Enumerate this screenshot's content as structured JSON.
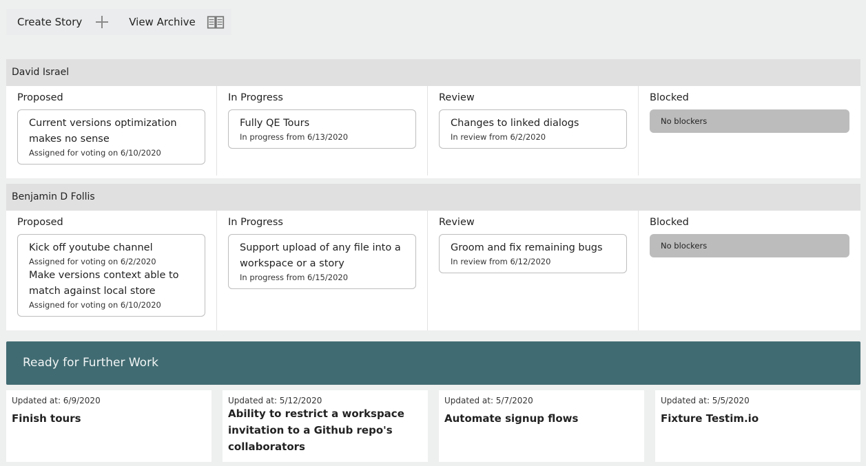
{
  "toolbar": {
    "create_label": "Create Story",
    "archive_label": "View Archive",
    "plus_icon": "plus-icon",
    "archive_icon": "book-icon"
  },
  "people": [
    {
      "name": "David Israel",
      "columns": [
        {
          "title": "Proposed",
          "cards": [
            {
              "title": "Current versions optimization makes no sense",
              "sub": "Assigned for voting on 6/10/2020"
            }
          ]
        },
        {
          "title": "In Progress",
          "cards": [
            {
              "title": "Fully QE Tours",
              "sub": "In progress from 6/13/2020"
            }
          ]
        },
        {
          "title": "Review",
          "cards": [
            {
              "title": "Changes to linked dialogs",
              "sub": "In review from 6/2/2020"
            }
          ]
        },
        {
          "title": "Blocked",
          "blocker": "No blockers"
        }
      ]
    },
    {
      "name": "Benjamin D Follis",
      "columns": [
        {
          "title": "Proposed",
          "cards": [
            {
              "title": "Kick off youtube channel",
              "sub": "Assigned for voting on 6/2/2020"
            },
            {
              "title": "Make versions context able to match against local store",
              "sub": "Assigned for voting on 6/10/2020"
            }
          ]
        },
        {
          "title": "In Progress",
          "cards": [
            {
              "title": "Support upload of any file into a workspace or a story",
              "sub": "In progress from 6/15/2020"
            }
          ]
        },
        {
          "title": "Review",
          "cards": [
            {
              "title": "Groom and fix remaining bugs",
              "sub": "In review from 6/12/2020"
            }
          ]
        },
        {
          "title": "Blocked",
          "blocker": "No blockers"
        }
      ]
    }
  ],
  "ready": {
    "title": "Ready for Further Work",
    "accent": "#416b72",
    "items": [
      {
        "updated": "Updated at: 6/9/2020",
        "title": "Finish tours"
      },
      {
        "updated": "Updated at: 5/12/2020",
        "title": "Ability to restrict a workspace invitation to a Github repo's collaborators"
      },
      {
        "updated": "Updated at: 5/7/2020",
        "title": "Automate signup flows"
      },
      {
        "updated": "Updated at: 5/5/2020",
        "title": "Fixture Testim.io"
      }
    ]
  }
}
